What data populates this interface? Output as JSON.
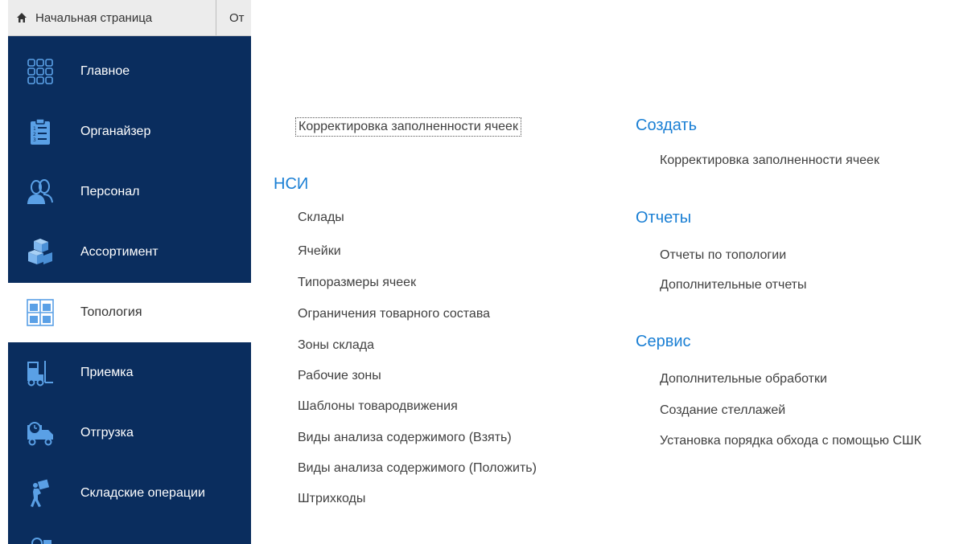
{
  "tabs": {
    "home_label": "Начальная страница",
    "next_label": "От"
  },
  "sidebar": {
    "items": [
      {
        "label": "Главное",
        "icon": "grid-icon"
      },
      {
        "label": "Органайзер",
        "icon": "clipboard-list-icon"
      },
      {
        "label": "Персонал",
        "icon": "people-icon"
      },
      {
        "label": "Ассортимент",
        "icon": "boxes-icon"
      },
      {
        "label": "Топология",
        "icon": "shelving-icon",
        "active": true
      },
      {
        "label": "Приемка",
        "icon": "forklift-icon"
      },
      {
        "label": "Отгрузка",
        "icon": "truck-clock-icon"
      },
      {
        "label": "Складские операции",
        "icon": "worker-carry-icon"
      }
    ]
  },
  "content": {
    "top_link": "Корректировка заполненности ячеек",
    "nsi": {
      "heading": "НСИ",
      "items": [
        "Склады",
        "Ячейки",
        "Типоразмеры ячеек",
        "Ограничения товарного состава",
        "Зоны склада",
        "Рабочие зоны",
        "Шаблоны товародвижения",
        "Виды анализа содержимого (Взять)",
        "Виды анализа содержимого (Положить)",
        "Штрихкоды"
      ]
    },
    "create": {
      "heading": "Создать",
      "items": [
        "Корректировка заполненности ячеек"
      ]
    },
    "reports": {
      "heading": "Отчеты",
      "items": [
        "Отчеты по топологии",
        "Дополнительные отчеты"
      ]
    },
    "service": {
      "heading": "Сервис",
      "items": [
        "Дополнительные обработки",
        "Создание стеллажей",
        "Установка порядка обхода с помощью СШК"
      ]
    }
  },
  "colors": {
    "sidebar_bg": "#0a2d5e",
    "heading": "#1a7fd4",
    "icon_accent": "#5aa0e6"
  }
}
